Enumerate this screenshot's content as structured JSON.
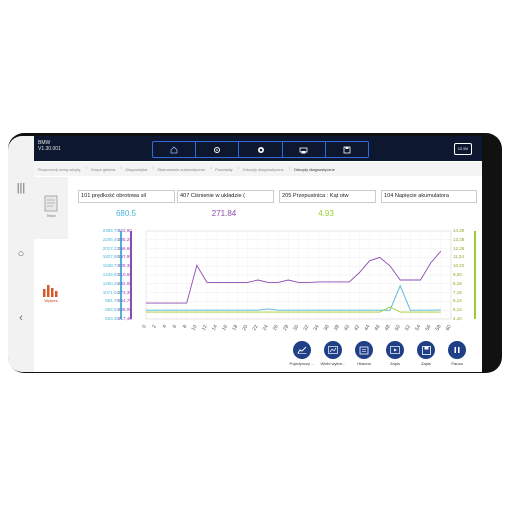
{
  "app": {
    "brand": "BMW",
    "version": "V1.30.001",
    "battery": "12.5V"
  },
  "toolbar": {
    "icons": [
      "home-icon",
      "gear-icon",
      "record-icon",
      "printer-icon",
      "save-icon"
    ]
  },
  "breadcrumbs": [
    "Rozpocznij nową wizytę",
    "Grupa główna",
    "Diagnostyka",
    "Skanowanie automatyczne",
    "Pozostały",
    "Odczyty diagnostyczne",
    "Odczyty diagnostyczne"
  ],
  "left_tabs": {
    "text": "Tekst",
    "chart": "Wykres"
  },
  "params": [
    {
      "label": "101 prędkość obrotowa sil",
      "value": "680.5",
      "color": "#4db5d8"
    },
    {
      "label": "407 Ciśnienie w układzie (",
      "value": "271.84",
      "color": "#8e4bb0"
    },
    {
      "label": "205 Przepustnica : Kąt otw",
      "value": "4.93",
      "color": "#9ccd2a"
    },
    {
      "label": "104 Napięcie akumulatora",
      "value": "",
      "color": "#2f56b8"
    }
  ],
  "axes": {
    "left1": [
      "2395,70",
      "2206,46",
      "2017,22",
      "1827,98",
      "1638,74",
      "1449,50",
      "1260,26",
      "1071,02",
      "881,78",
      "692,54",
      "503,30"
    ],
    "left2": [
      "403,90",
      "385,25",
      "366,60",
      "347,95",
      "329,30",
      "310,65",
      "292,00",
      "273,35",
      "254,70",
      "236,05",
      "217,40"
    ],
    "right": [
      "14,30",
      "13,28",
      "12,26",
      "11,24",
      "10,22",
      "9,20",
      "8,18",
      "7,16",
      "6,14",
      "5,12",
      "4,10"
    ],
    "x": [
      "0",
      "2",
      "4",
      "6",
      "8",
      "10",
      "12",
      "14",
      "16",
      "18",
      "20",
      "22",
      "24",
      "26",
      "28",
      "30",
      "32",
      "34",
      "36",
      "38",
      "40",
      "42",
      "44",
      "46",
      "48",
      "50",
      "52",
      "54",
      "56",
      "58",
      "60"
    ]
  },
  "chart_data": {
    "type": "line",
    "x": [
      0,
      2,
      4,
      6,
      8,
      10,
      12,
      14,
      16,
      18,
      20,
      22,
      24,
      26,
      28,
      30,
      32,
      34,
      36,
      38,
      40,
      42,
      44,
      46,
      48,
      50,
      52,
      54,
      56,
      58
    ],
    "series": [
      {
        "name": "407 Ciśnienie w układzie (",
        "axis": "left2",
        "color": "#8e4bb0",
        "values": [
          251,
          251,
          251,
          251,
          251,
          331,
          295,
          295,
          295,
          295,
          295,
          300,
          295,
          295,
          300,
          295,
          295,
          296,
          296,
          296,
          296,
          316,
          341,
          348,
          330,
          300,
          300,
          300,
          336,
          361
        ]
      },
      {
        "name": "101 prędkość obrotowa sil",
        "axis": "left1",
        "color": "#4db5d8",
        "values": [
          692,
          692,
          692,
          692,
          692,
          692,
          692,
          692,
          692,
          692,
          692,
          692,
          720,
          692,
          692,
          692,
          692,
          692,
          692,
          692,
          692,
          692,
          692,
          692,
          692,
          1220,
          692,
          692,
          692,
          700
        ]
      },
      {
        "name": "205 Przepustnica : Kąt otw",
        "axis": "right",
        "color": "#9ccd2a",
        "values": [
          4.9,
          4.9,
          4.9,
          4.9,
          4.9,
          4.9,
          4.9,
          4.9,
          4.9,
          4.9,
          4.9,
          4.9,
          4.9,
          4.9,
          4.9,
          4.9,
          4.9,
          4.9,
          4.9,
          4.9,
          4.9,
          4.9,
          4.9,
          4.9,
          5.5,
          4.9,
          4.9,
          4.9,
          4.9,
          4.9
        ]
      }
    ],
    "ylim_left1": [
      503.3,
      2395.7
    ],
    "ylim_left2": [
      217.4,
      403.9
    ],
    "ylim_right": [
      4.1,
      14.3
    ],
    "xlim": [
      0,
      60
    ],
    "grid": true
  },
  "bottom_buttons": [
    "Pojedynczy ...",
    "Wiele wykre...",
    "Historia",
    "Zapis",
    "Zapis",
    "Pauza"
  ]
}
